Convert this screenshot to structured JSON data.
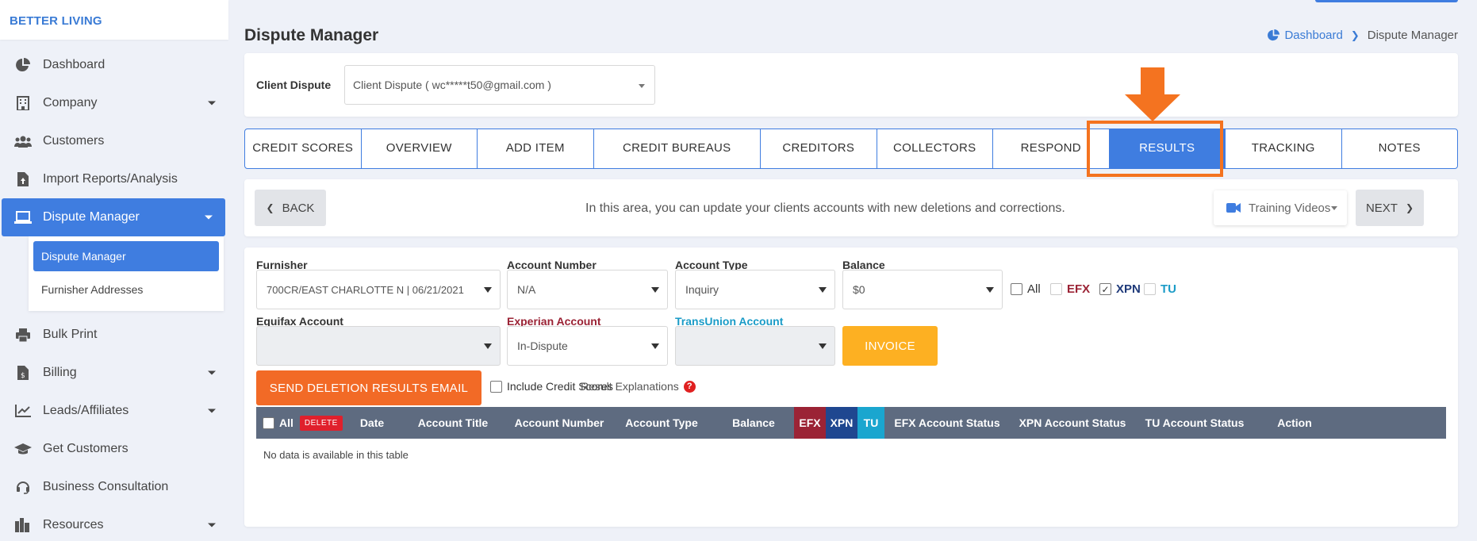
{
  "brand": "BETTER LIVING",
  "sidebar": {
    "items": [
      {
        "label": "Dashboard"
      },
      {
        "label": "Company"
      },
      {
        "label": "Customers"
      },
      {
        "label": "Import Reports/Analysis"
      },
      {
        "label": "Dispute Manager"
      },
      {
        "label": "Bulk Print"
      },
      {
        "label": "Billing"
      },
      {
        "label": "Leads/Affiliates"
      },
      {
        "label": "Get Customers"
      },
      {
        "label": "Business Consultation"
      },
      {
        "label": "Resources"
      }
    ],
    "submenu": [
      {
        "label": "Dispute Manager"
      },
      {
        "label": "Furnisher Addresses"
      }
    ]
  },
  "header": {
    "title": "Dispute Manager",
    "breadcrumb": {
      "home": "Dashboard",
      "current": "Dispute Manager"
    }
  },
  "client": {
    "label": "Client Dispute",
    "selected": "Client Dispute ( wc*****t50@gmail.com )"
  },
  "tabs": [
    {
      "label": "CREDIT SCORES"
    },
    {
      "label": "OVERVIEW"
    },
    {
      "label": "ADD ITEM"
    },
    {
      "label": "CREDIT BUREAUS"
    },
    {
      "label": "CREDITORS"
    },
    {
      "label": "COLLECTORS"
    },
    {
      "label": "RESPOND"
    },
    {
      "label": "RESULTS"
    },
    {
      "label": "TRACKING"
    },
    {
      "label": "NOTES"
    }
  ],
  "info": {
    "back": "BACK",
    "text": "In this area, you can update your clients accounts with new deletions and corrections.",
    "training": "Training Videos",
    "next": "NEXT"
  },
  "form": {
    "furnisher": {
      "label": "Furnisher",
      "value": "700CR/EAST CHARLOTTE N | 06/21/2021"
    },
    "account_number": {
      "label": "Account Number",
      "value": "N/A"
    },
    "account_type": {
      "label": "Account Type",
      "value": "Inquiry"
    },
    "balance": {
      "label": "Balance",
      "value": "$0"
    },
    "bureaus": {
      "all": "All",
      "efx": "EFX",
      "xpn": "XPN",
      "tu": "TU",
      "xpn_checked": "✓"
    },
    "equifax": {
      "label": "Equifax Account",
      "value": ""
    },
    "experian": {
      "label": "Experian Account",
      "value": "In-Dispute"
    },
    "transunion": {
      "label": "TransUnion Account",
      "value": ""
    },
    "invoice": "INVOICE",
    "send": "SEND DELETION RESULTS EMAIL",
    "include_scores": "Include Credit Scores",
    "result_explanations": "Result Explanations",
    "qmark": "?"
  },
  "table": {
    "all": "All",
    "delete": "DELETE",
    "columns": [
      "Date",
      "Account Title",
      "Account Number",
      "Account Type",
      "Balance",
      "EFX",
      "XPN",
      "TU",
      "EFX Account Status",
      "XPN Account Status",
      "TU Account Status",
      "Action"
    ],
    "empty": "No data is available in this table"
  },
  "colors": {
    "accent": "#3f7de0",
    "highlight": "#f47320",
    "efx": "#9b2335",
    "xpn": "#1f4790",
    "tu": "#1aa6cf"
  }
}
